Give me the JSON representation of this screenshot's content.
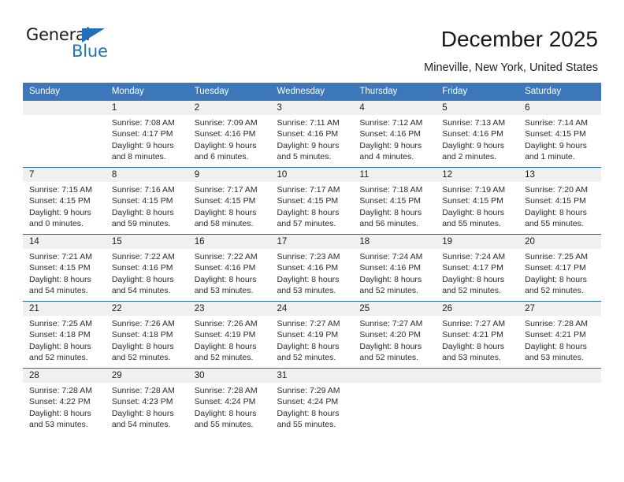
{
  "brand": {
    "name_primary": "General",
    "name_secondary": "Blue",
    "triangle_color": "#1f6fba",
    "text_color": "#1b1b1b",
    "accent_color": "#1f72bd"
  },
  "header": {
    "title": "December 2025",
    "subtitle": "Mineville, New York, United States",
    "header_bg": "#3b77b9",
    "header_text": "#ffffff",
    "week_separator_color": "#2b6cab",
    "daynum_band_color": "#f0f0f0"
  },
  "weekday_headers": [
    "Sunday",
    "Monday",
    "Tuesday",
    "Wednesday",
    "Thursday",
    "Friday",
    "Saturday"
  ],
  "weeks": [
    [
      {
        "day": "",
        "lines": []
      },
      {
        "day": "1",
        "lines": [
          "Sunrise: 7:08 AM",
          "Sunset: 4:17 PM",
          "Daylight: 9 hours",
          "and 8 minutes."
        ]
      },
      {
        "day": "2",
        "lines": [
          "Sunrise: 7:09 AM",
          "Sunset: 4:16 PM",
          "Daylight: 9 hours",
          "and 6 minutes."
        ]
      },
      {
        "day": "3",
        "lines": [
          "Sunrise: 7:11 AM",
          "Sunset: 4:16 PM",
          "Daylight: 9 hours",
          "and 5 minutes."
        ]
      },
      {
        "day": "4",
        "lines": [
          "Sunrise: 7:12 AM",
          "Sunset: 4:16 PM",
          "Daylight: 9 hours",
          "and 4 minutes."
        ]
      },
      {
        "day": "5",
        "lines": [
          "Sunrise: 7:13 AM",
          "Sunset: 4:16 PM",
          "Daylight: 9 hours",
          "and 2 minutes."
        ]
      },
      {
        "day": "6",
        "lines": [
          "Sunrise: 7:14 AM",
          "Sunset: 4:15 PM",
          "Daylight: 9 hours",
          "and 1 minute."
        ]
      }
    ],
    [
      {
        "day": "7",
        "lines": [
          "Sunrise: 7:15 AM",
          "Sunset: 4:15 PM",
          "Daylight: 9 hours",
          "and 0 minutes."
        ]
      },
      {
        "day": "8",
        "lines": [
          "Sunrise: 7:16 AM",
          "Sunset: 4:15 PM",
          "Daylight: 8 hours",
          "and 59 minutes."
        ]
      },
      {
        "day": "9",
        "lines": [
          "Sunrise: 7:17 AM",
          "Sunset: 4:15 PM",
          "Daylight: 8 hours",
          "and 58 minutes."
        ]
      },
      {
        "day": "10",
        "lines": [
          "Sunrise: 7:17 AM",
          "Sunset: 4:15 PM",
          "Daylight: 8 hours",
          "and 57 minutes."
        ]
      },
      {
        "day": "11",
        "lines": [
          "Sunrise: 7:18 AM",
          "Sunset: 4:15 PM",
          "Daylight: 8 hours",
          "and 56 minutes."
        ]
      },
      {
        "day": "12",
        "lines": [
          "Sunrise: 7:19 AM",
          "Sunset: 4:15 PM",
          "Daylight: 8 hours",
          "and 55 minutes."
        ]
      },
      {
        "day": "13",
        "lines": [
          "Sunrise: 7:20 AM",
          "Sunset: 4:15 PM",
          "Daylight: 8 hours",
          "and 55 minutes."
        ]
      }
    ],
    [
      {
        "day": "14",
        "lines": [
          "Sunrise: 7:21 AM",
          "Sunset: 4:15 PM",
          "Daylight: 8 hours",
          "and 54 minutes."
        ]
      },
      {
        "day": "15",
        "lines": [
          "Sunrise: 7:22 AM",
          "Sunset: 4:16 PM",
          "Daylight: 8 hours",
          "and 54 minutes."
        ]
      },
      {
        "day": "16",
        "lines": [
          "Sunrise: 7:22 AM",
          "Sunset: 4:16 PM",
          "Daylight: 8 hours",
          "and 53 minutes."
        ]
      },
      {
        "day": "17",
        "lines": [
          "Sunrise: 7:23 AM",
          "Sunset: 4:16 PM",
          "Daylight: 8 hours",
          "and 53 minutes."
        ]
      },
      {
        "day": "18",
        "lines": [
          "Sunrise: 7:24 AM",
          "Sunset: 4:16 PM",
          "Daylight: 8 hours",
          "and 52 minutes."
        ]
      },
      {
        "day": "19",
        "lines": [
          "Sunrise: 7:24 AM",
          "Sunset: 4:17 PM",
          "Daylight: 8 hours",
          "and 52 minutes."
        ]
      },
      {
        "day": "20",
        "lines": [
          "Sunrise: 7:25 AM",
          "Sunset: 4:17 PM",
          "Daylight: 8 hours",
          "and 52 minutes."
        ]
      }
    ],
    [
      {
        "day": "21",
        "lines": [
          "Sunrise: 7:25 AM",
          "Sunset: 4:18 PM",
          "Daylight: 8 hours",
          "and 52 minutes."
        ]
      },
      {
        "day": "22",
        "lines": [
          "Sunrise: 7:26 AM",
          "Sunset: 4:18 PM",
          "Daylight: 8 hours",
          "and 52 minutes."
        ]
      },
      {
        "day": "23",
        "lines": [
          "Sunrise: 7:26 AM",
          "Sunset: 4:19 PM",
          "Daylight: 8 hours",
          "and 52 minutes."
        ]
      },
      {
        "day": "24",
        "lines": [
          "Sunrise: 7:27 AM",
          "Sunset: 4:19 PM",
          "Daylight: 8 hours",
          "and 52 minutes."
        ]
      },
      {
        "day": "25",
        "lines": [
          "Sunrise: 7:27 AM",
          "Sunset: 4:20 PM",
          "Daylight: 8 hours",
          "and 52 minutes."
        ]
      },
      {
        "day": "26",
        "lines": [
          "Sunrise: 7:27 AM",
          "Sunset: 4:21 PM",
          "Daylight: 8 hours",
          "and 53 minutes."
        ]
      },
      {
        "day": "27",
        "lines": [
          "Sunrise: 7:28 AM",
          "Sunset: 4:21 PM",
          "Daylight: 8 hours",
          "and 53 minutes."
        ]
      }
    ],
    [
      {
        "day": "28",
        "lines": [
          "Sunrise: 7:28 AM",
          "Sunset: 4:22 PM",
          "Daylight: 8 hours",
          "and 53 minutes."
        ]
      },
      {
        "day": "29",
        "lines": [
          "Sunrise: 7:28 AM",
          "Sunset: 4:23 PM",
          "Daylight: 8 hours",
          "and 54 minutes."
        ]
      },
      {
        "day": "30",
        "lines": [
          "Sunrise: 7:28 AM",
          "Sunset: 4:24 PM",
          "Daylight: 8 hours",
          "and 55 minutes."
        ]
      },
      {
        "day": "31",
        "lines": [
          "Sunrise: 7:29 AM",
          "Sunset: 4:24 PM",
          "Daylight: 8 hours",
          "and 55 minutes."
        ]
      },
      {
        "day": "",
        "lines": []
      },
      {
        "day": "",
        "lines": []
      },
      {
        "day": "",
        "lines": []
      }
    ]
  ]
}
